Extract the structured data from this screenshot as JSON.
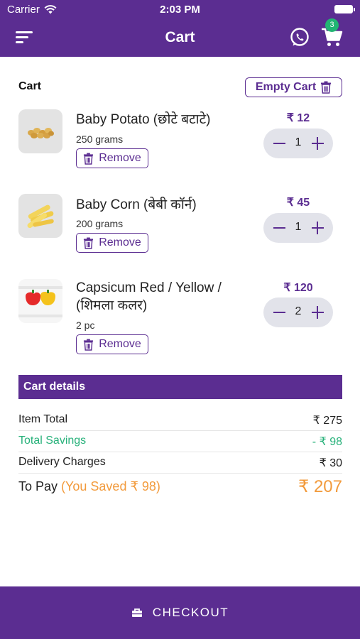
{
  "status_bar": {
    "carrier": "Carrier",
    "time": "2:03 PM"
  },
  "header": {
    "title": "Cart",
    "cart_badge": "3"
  },
  "section": {
    "label": "Cart",
    "empty_label": "Empty Cart"
  },
  "items": [
    {
      "name": "Baby Potato (छोटे बटाटे)",
      "quantity_text": "250 grams",
      "remove_label": "Remove",
      "price": "₹ 12",
      "count": "1"
    },
    {
      "name": "Baby Corn (बेबी कॉर्न)",
      "quantity_text": "200 grams",
      "remove_label": "Remove",
      "price": "₹ 45",
      "count": "1"
    },
    {
      "name": "Capsicum Red / Yellow / (शिमला कलर)",
      "quantity_text": "2 pc",
      "remove_label": "Remove",
      "price": "₹ 120",
      "count": "2"
    }
  ],
  "details": {
    "heading": "Cart details",
    "item_total_label": "Item Total",
    "item_total_value": "₹ 275",
    "savings_label": "Total Savings",
    "savings_value": "- ₹ 98",
    "delivery_label": "Delivery Charges",
    "delivery_value": "₹ 30",
    "to_pay_label": "To Pay",
    "saved_note": "(You Saved ₹ 98)",
    "to_pay_value": "₹ 207"
  },
  "checkout": {
    "label": "CHECKOUT"
  },
  "colors": {
    "brand": "#5b2d91",
    "savings": "#27b17a",
    "accent": "#f29a3b",
    "badge": "#22b573"
  }
}
